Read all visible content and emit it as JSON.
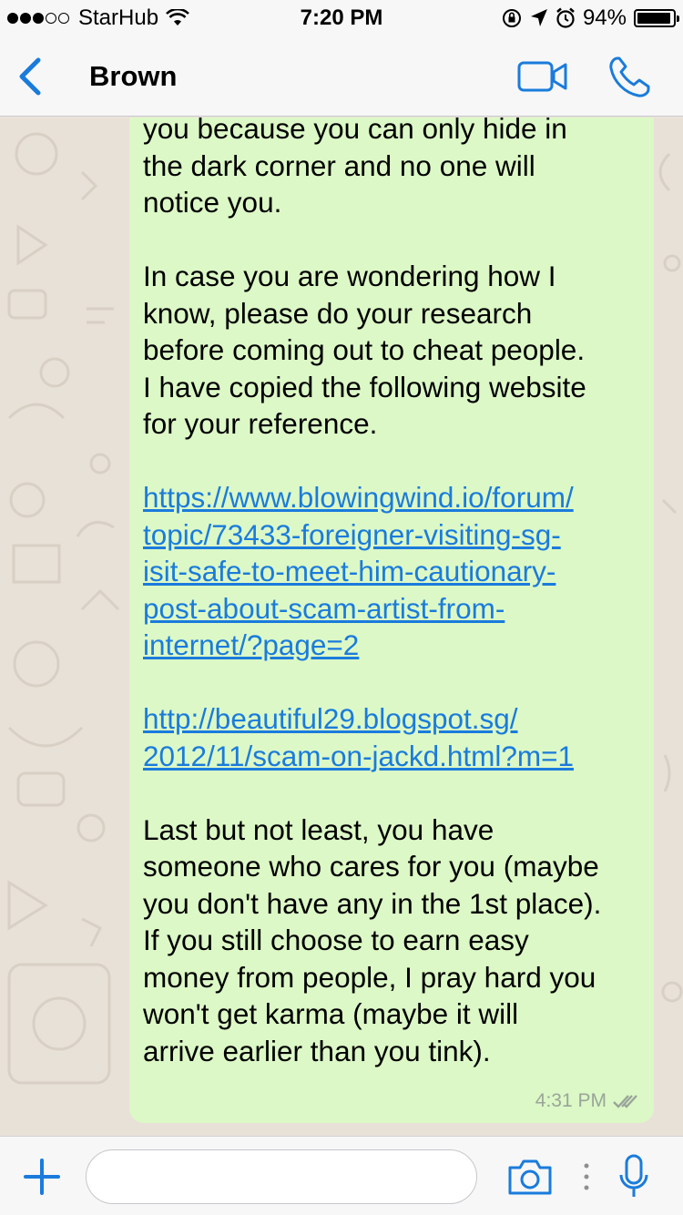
{
  "status_bar": {
    "carrier": "StarHub",
    "time": "7:20 PM",
    "battery": "94%",
    "battery_level": 0.94,
    "signal_bars_filled": 3,
    "signal_bars_total": 5
  },
  "header": {
    "contact_name": "Brown",
    "back_icon": "chevron-left-icon",
    "video_icon": "video-camera-icon",
    "call_icon": "phone-icon"
  },
  "message": {
    "paragraphs": [
      "you because you can only hide in\nthe dark corner and no one will\nnotice you.",
      "In case you are wondering how I\nknow, please do your research\nbefore coming out to cheat people.\nI have copied the following website\nfor your reference."
    ],
    "links": [
      "https://www.blowingwind.io/forum/\ntopic/73433-foreigner-visiting-sg-\nisit-safe-to-meet-him-cautionary-\npost-about-scam-artist-from-\ninternet/?page=2",
      "http://beautiful29.blogspot.sg/\n2012/11/scam-on-jackd.html?m=1"
    ],
    "closing": "Last but not least, you have\nsomeone who cares for you (maybe\nyou don't have any in the 1st place).\nIf you still choose to earn easy\nmoney from people, I pray hard you\nwon't get karma (maybe it will\narrive earlier than you tink).",
    "time": "4:31 PM",
    "status_icon": "double-check-icon"
  },
  "composer": {
    "placeholder": "",
    "icons": [
      "plus-icon",
      "camera-icon",
      "more-dots-icon",
      "microphone-icon"
    ]
  },
  "colors": {
    "accent": "#1a7bdc",
    "bubble": "#dcf8c6",
    "background": "#e8e1d8"
  }
}
